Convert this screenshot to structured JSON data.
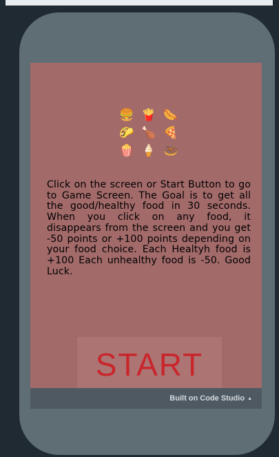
{
  "foods": [
    {
      "icon": "🍔",
      "name": "burger-icon"
    },
    {
      "icon": "🍟",
      "name": "fries-icon"
    },
    {
      "icon": "🌭",
      "name": "hotdog-icon"
    },
    {
      "icon": "🌮",
      "name": "taco-icon"
    },
    {
      "icon": "🍗",
      "name": "chicken-icon"
    },
    {
      "icon": "🍕",
      "name": "pizza-icon"
    },
    {
      "icon": "🍿",
      "name": "popcorn-icon"
    },
    {
      "icon": "🍦",
      "name": "ice-cream-icon"
    },
    {
      "icon": "🍩",
      "name": "donut-icon"
    }
  ],
  "instructions": "Click on the screen or Start Button to go to Game Screen. The Goal is to get all the good/healthy food in 30 seconds.  When you click on any food, it disappears from the screen and you get -50 points or +100 points depending on your food choice.  Each Healtyh food is +100 Each unhealthy food is -50. Good Luck.",
  "start_label": "START",
  "footer": {
    "label": "Built on Code Studio",
    "caret": "▲"
  },
  "colors": {
    "screen_bg": "#a36a6a",
    "start_text": "#c9262c",
    "phone_body": "#5f6d75"
  }
}
